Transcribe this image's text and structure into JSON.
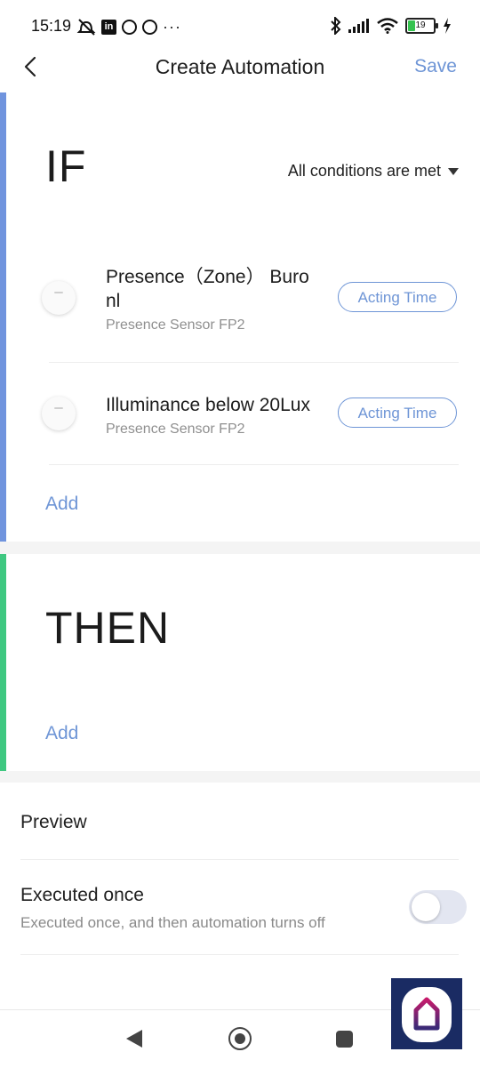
{
  "status_bar": {
    "time": "15:19",
    "battery": "19",
    "left_icons": [
      "muted-alarm-icon",
      "linkedin-icon",
      "circle-icon",
      "circle-icon",
      "more-dots-icon"
    ],
    "right_icons": [
      "bluetooth-icon",
      "signal-icon",
      "wifi-icon",
      "battery-icon",
      "charging-icon"
    ]
  },
  "header": {
    "title": "Create Automation",
    "save_label": "Save"
  },
  "if_section": {
    "label": "IF",
    "condition_mode": "All conditions are met",
    "accent_color": "#7094de",
    "conditions": [
      {
        "title": "Presence（Zone） Buro nl",
        "subtitle": "Presence Sensor FP2",
        "action": "Acting Time"
      },
      {
        "title": "Illuminance below 20Lux",
        "subtitle": "Presence Sensor FP2",
        "action": "Acting Time"
      }
    ],
    "add_label": "Add"
  },
  "then_section": {
    "label": "THEN",
    "accent_color": "#3fc881",
    "add_label": "Add"
  },
  "settings": {
    "preview_label": "Preview",
    "executed_once_title": "Executed once",
    "executed_once_subtitle": "Executed once, and then automation turns off",
    "executed_once_enabled": false
  },
  "colors": {
    "link": "#6e95d6",
    "app_badge": "#1a2b63"
  }
}
